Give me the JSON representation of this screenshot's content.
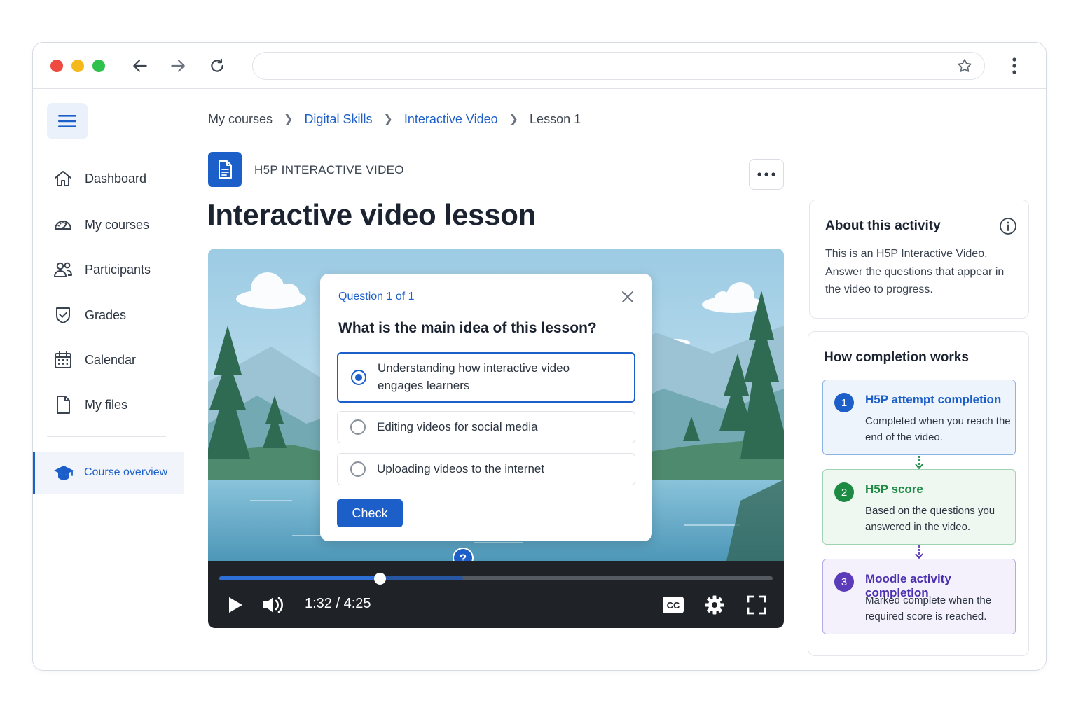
{
  "browser": {
    "icons": [
      "arrow-left-icon",
      "arrow-right-icon",
      "reload-icon",
      "star-icon",
      "kebab-icon"
    ]
  },
  "sidebar": {
    "items": [
      {
        "label": "Dashboard",
        "icon": "home-icon"
      },
      {
        "label": "My courses",
        "icon": "gauge-icon"
      },
      {
        "label": "Participants",
        "icon": "people-icon"
      },
      {
        "label": "Grades",
        "icon": "shield-check-icon"
      },
      {
        "label": "Calendar",
        "icon": "calendar-icon"
      },
      {
        "label": "My files",
        "icon": "file-icon"
      }
    ],
    "active": {
      "label": "Course overview",
      "icon": "graduation-cap-icon"
    }
  },
  "breadcrumb": [
    "My courses",
    "Digital Skills",
    "Interactive Video",
    "Lesson 1"
  ],
  "activity": {
    "type_label": "H5P INTERACTIVE VIDEO",
    "title": "Interactive video lesson"
  },
  "quiz": {
    "count": "Question 1 of 1",
    "question": "What is the main idea of this lesson?",
    "options": [
      {
        "label": "Understanding how interactive video engages learners",
        "selected": true
      },
      {
        "label": "Editing videos for social media",
        "selected": false
      },
      {
        "label": "Uploading videos to the internet",
        "selected": false
      }
    ],
    "check_label": "Check"
  },
  "player": {
    "time": "1:32 / 4:25",
    "played_fraction": 0.29,
    "buffered_fraction": 0.44,
    "question_marker_fraction": 0.44,
    "marker_label": "?",
    "cc_label": "CC"
  },
  "about": {
    "title": "About this activity",
    "text": "This is an H5P Interactive Video. Answer the questions that appear in the video to progress."
  },
  "completion": {
    "title": "How completion works",
    "steps": [
      {
        "num": "1",
        "title": "H5P attempt completion",
        "desc": "Completed when you reach the end of the video."
      },
      {
        "num": "2",
        "title": "H5P score",
        "desc": "Based on the questions you answered in the video."
      },
      {
        "num": "3",
        "title": "Moodle activity completion",
        "desc": "Marked complete when the required score is reached."
      }
    ]
  },
  "colors": {
    "accent": "#1d5fc9",
    "step2": "#1d8a44",
    "step3": "#5b3bb9"
  }
}
